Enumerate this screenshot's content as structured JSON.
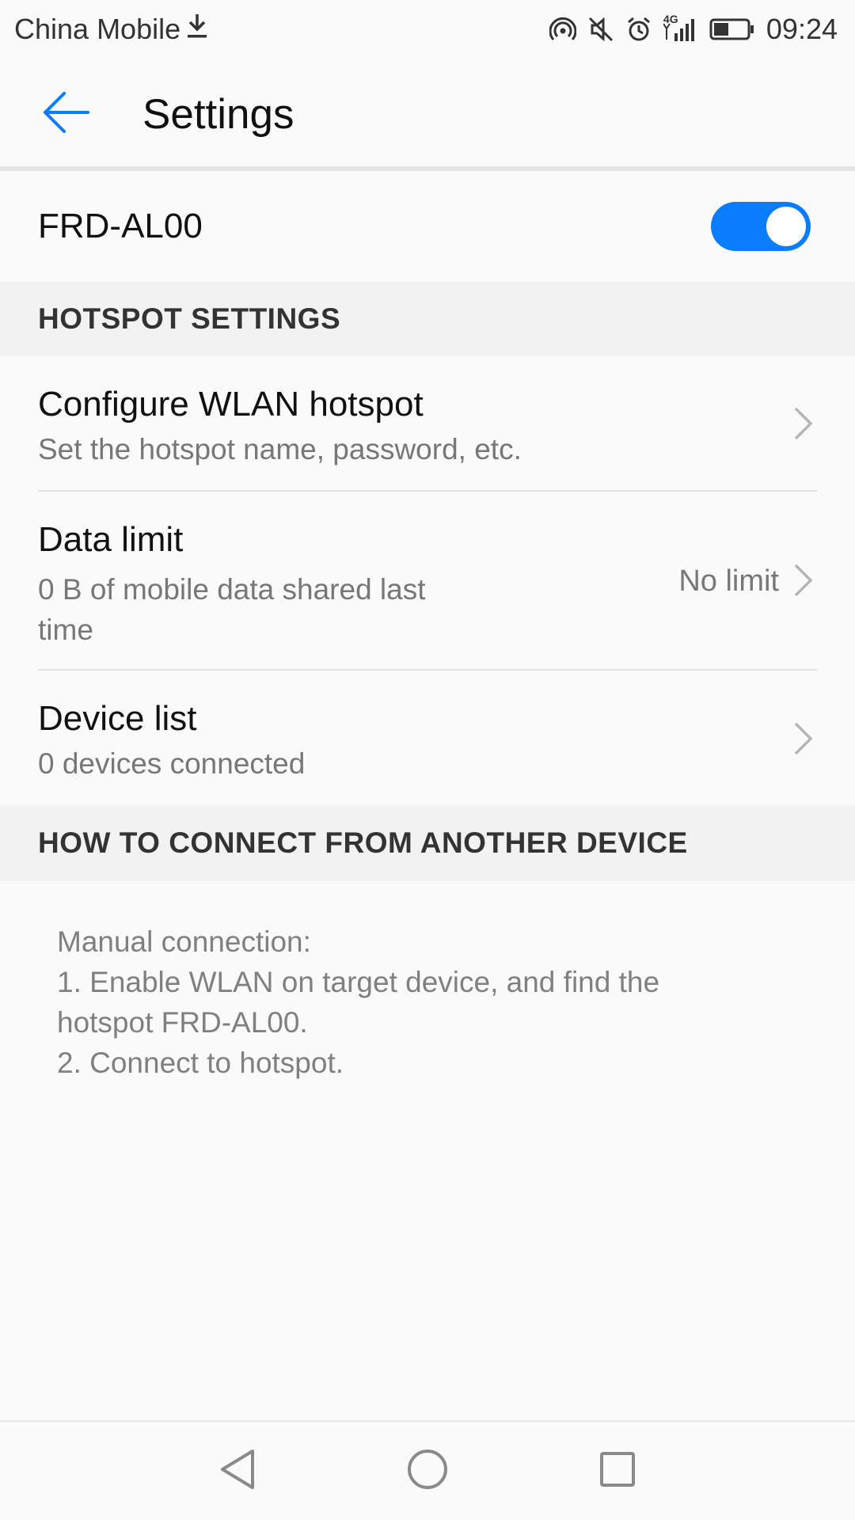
{
  "status_bar": {
    "carrier": "China Mobile",
    "network_type": "4G",
    "time": "09:24",
    "icons": [
      "download-icon",
      "hotspot-icon",
      "mute-icon",
      "alarm-icon",
      "signal-icon",
      "battery-icon"
    ]
  },
  "app_bar": {
    "title": "Settings",
    "back_icon": "back-arrow-icon"
  },
  "hotspot_toggle": {
    "label": "FRD-AL00",
    "enabled": true
  },
  "hotspot_settings": {
    "header": "HOTSPOT SETTINGS",
    "items": [
      {
        "title": "Configure WLAN hotspot",
        "subtitle": "Set the hotspot name, password, etc."
      },
      {
        "title": "Data limit",
        "subtitle_line1": "0 B of mobile data shared last",
        "subtitle_line2": "time",
        "value": "No limit"
      },
      {
        "title": "Device list",
        "subtitle": "0 devices connected"
      }
    ]
  },
  "how_to_connect": {
    "header": "HOW TO CONNECT FROM ANOTHER DEVICE",
    "lines": [
      "Manual connection:",
      "1. Enable WLAN on target device, and find the",
      "hotspot FRD-AL00.",
      "2. Connect to hotspot."
    ]
  },
  "nav_bar": {
    "icons": [
      "nav-back-icon",
      "nav-home-icon",
      "nav-recents-icon"
    ]
  },
  "colors": {
    "accent": "#0a7cff",
    "background": "#fafafa",
    "section_header_bg": "#f2f2f2",
    "secondary_text": "#777777"
  }
}
